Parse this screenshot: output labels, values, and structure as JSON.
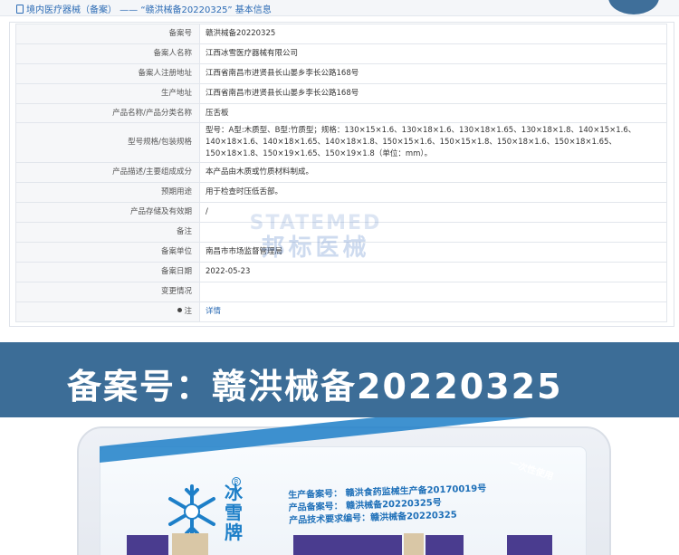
{
  "header": {
    "breadcrumb": "境内医疗器械（备案） —— “赣洪械备20220325” 基本信息"
  },
  "table": {
    "rows": [
      {
        "label": "备案号",
        "value": "赣洪械备20220325"
      },
      {
        "label": "备案人名称",
        "value": "江西冰雪医疗器械有限公司"
      },
      {
        "label": "备案人注册地址",
        "value": "江西省南昌市进贤县长山晏乡李长公路168号"
      },
      {
        "label": "生产地址",
        "value": "江西省南昌市进贤县长山晏乡李长公路168号"
      },
      {
        "label": "产品名称/产品分类名称",
        "value": "压舌板"
      },
      {
        "label": "型号规格/包装规格",
        "value": "型号：A型:木质型、B型:竹质型；规格：130×15×1.6、130×18×1.6、130×18×1.65、130×18×1.8、140×15×1.6、140×18×1.6、140×18×1.65、140×18×1.8、150×15×1.6、150×15×1.8、150×18×1.6、150×18×1.65、150×18×1.8、150×19×1.65、150×19×1.8（单位：mm）。"
      },
      {
        "label": "产品描述/主要组成成分",
        "value": "本产品由木质或竹质材料制成。"
      },
      {
        "label": "预期用途",
        "value": "用于检查时压低舌部。"
      },
      {
        "label": "产品存储及有效期",
        "value": "/"
      },
      {
        "label": "备注",
        "value": ""
      },
      {
        "label": "备案单位",
        "value": "南昌市市场监督管理局"
      },
      {
        "label": "备案日期",
        "value": "2022-05-23"
      },
      {
        "label": "变更情况",
        "value": ""
      },
      {
        "label": "注",
        "value": "详情"
      }
    ]
  },
  "watermark": {
    "line1": "STATEMED",
    "line2": "邦标医械"
  },
  "banner": {
    "text": "备案号：赣洪械备20220325"
  },
  "photo": {
    "brand": "冰雪牌",
    "reg_mark": "R",
    "side_text": "一次性使用",
    "lines": [
      "生产备案号：  赣洪食药监械生产备20170019号",
      "产品备案号：  赣洪械备20220325号",
      "产品技术要求编号：赣洪械备20220325"
    ]
  },
  "colors": {
    "link": "#2d6cb5",
    "banner_bg": "#3c6d97",
    "brand_blue": "#1d7fc8"
  }
}
